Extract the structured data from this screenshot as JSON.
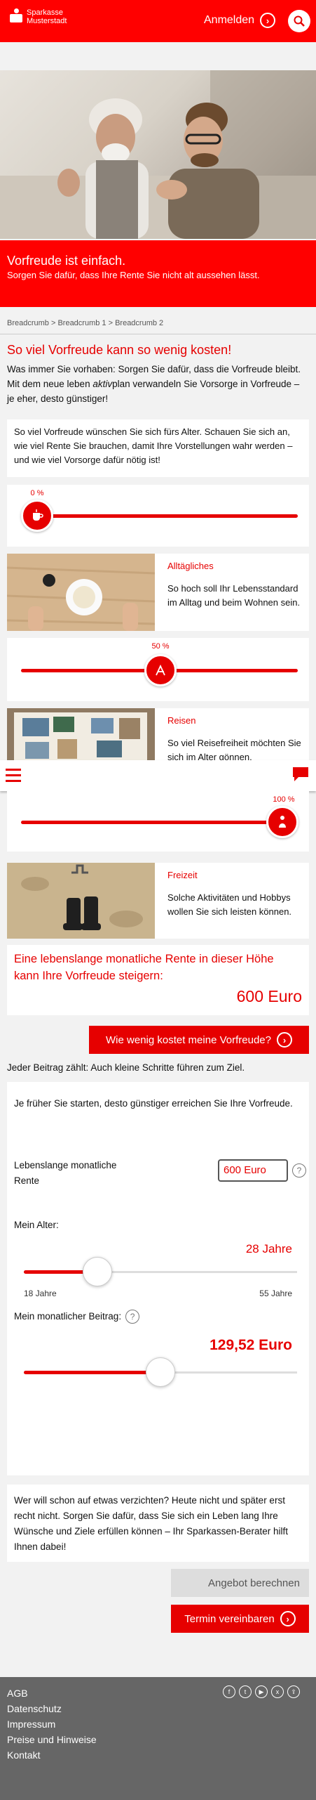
{
  "header": {
    "brand_line1": "Sparkasse",
    "brand_line2": "Musterstadt",
    "login_label": "Anmelden",
    "login_icon": "chevron-right-icon",
    "search_icon": "search-icon"
  },
  "banner": {
    "title": "Vorfreude ist einfach.",
    "subtitle": "Sorgen Sie dafür, dass Ihre Rente Sie nicht alt aussehen lässt."
  },
  "breadcrumb": "Breadcrumb > Breadcrumb 1 > Breadcrumb 2",
  "intro": {
    "heading": "So viel Vorfreude kann so wenig kosten!",
    "text_before": "Was immer Sie vorhaben: Sorgen Sie dafür, dass die Vorfreude bleibt. Mit dem neue leben ",
    "text_em": "aktiv",
    "text_after": "plan verwandeln Sie Vorsorge in Vorfreude – je eher, desto günstiger!"
  },
  "explain": "So viel Vorfreude wünschen Sie sich fürs Alter. Schauen Sie sich an, wie viel Rente Sie brauchen, damit Ihre Vorstellungen wahr werden – und wie viel Vorsorge dafür nötig ist!",
  "sliders": [
    {
      "label": "0 %",
      "value": 0,
      "icon": "cup-icon"
    },
    {
      "label": "50 %",
      "value": 50,
      "icon": "deckchair-icon"
    },
    {
      "label": "100 %",
      "value": 100,
      "icon": "golfer-icon"
    }
  ],
  "features": [
    {
      "title": "Alltägliches",
      "text": "So hoch soll Ihr Lebensstandard im Alltag und beim Wohnen sein."
    },
    {
      "title": "Reisen",
      "text": "So viel Reisefreiheit möchten Sie sich im Alter gönnen."
    },
    {
      "title": "Freizeit",
      "text": "Solche Aktivitäten und Hobbys wollen Sie sich leisten können."
    }
  ],
  "result": {
    "text": "Eine lebenslange monatliche Rente in dieser Höhe kann Ihre Vorfreude steigern:",
    "amount": "600 Euro",
    "cta": "Wie wenig kostet meine Vorfreude?"
  },
  "tagline": "Jeder Beitrag zählt: Auch kleine Schritte führen zum Ziel.",
  "calculator": {
    "intro": "Je früher Sie starten, desto günstiger erreichen Sie Ihre Vorfreude.",
    "pension_label": "Lebenslange monatliche Rente",
    "pension_value": "600 Euro",
    "age_label": "Mein Alter:",
    "age_value": "28 Jahre",
    "age_min": "18 Jahre",
    "age_max": "55 Jahre",
    "age_fraction": 0.27,
    "contribution_label": "Mein monatlicher Beitrag:",
    "contribution_value": "129,52 Euro",
    "contribution_fraction": 0.5
  },
  "closing": "Wer will schon auf etwas verzichten? Heute nicht und später erst recht nicht. Sorgen Sie dafür, dass Sie sich ein Leben lang Ihre Wünsche und Ziele erfüllen können – Ihr Sparkassen-Berater hilft Ihnen dabei!",
  "buttons": {
    "calculate": "Angebot berechnen",
    "appointment": "Termin vereinbaren"
  },
  "footer": {
    "links": [
      "AGB",
      "Datenschutz",
      "Impressum",
      "Preise und Hinweise",
      "Kontakt"
    ],
    "social": [
      "facebook-icon",
      "twitter-icon",
      "youtube-icon",
      "xing-icon",
      "share-icon"
    ]
  },
  "colors": {
    "brand_red": "#ff0000",
    "accent_red": "#e60000",
    "footer_grey": "#666666"
  }
}
